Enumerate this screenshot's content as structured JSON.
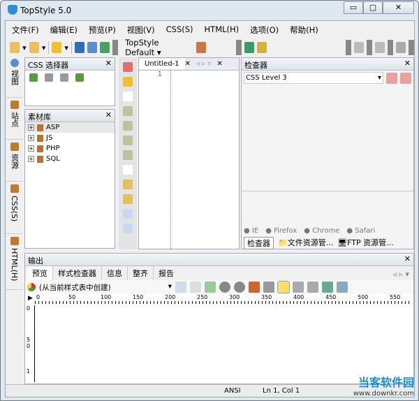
{
  "window": {
    "title": "TopStyle 5.0",
    "min": "▭",
    "max": "▢",
    "close": "✕"
  },
  "menu": [
    "文件(F)",
    "编辑(E)",
    "预览(P)",
    "视图(V)",
    "CSS(S)",
    "HTML(H)",
    "选项(O)",
    "帮助(H)"
  ],
  "toolbar": {
    "theme": "TopStyle Default ▾"
  },
  "vtabs": [
    "视图",
    "站点",
    "资源",
    "CSS(S)",
    "HTML(H)"
  ],
  "css_selector": {
    "title": "CSS 选择器",
    "close": "✕"
  },
  "assets": {
    "title": "素材库",
    "close": "✕",
    "items": [
      "ASP",
      "JS",
      "PHP",
      "SQL"
    ]
  },
  "editor": {
    "tab": "Untitled-1",
    "tab_close": "✕",
    "close": "✕",
    "line": "1"
  },
  "inspector": {
    "title": "检查器",
    "close": "✕",
    "level": "CSS Level 3",
    "browsers": [
      "IE",
      "Firefox",
      "Chrome",
      "Safari"
    ],
    "tabs": [
      "检查器",
      "文件资源管...",
      "FTP 资源管..."
    ]
  },
  "output": {
    "title": "输出",
    "close": "✕",
    "tabs": [
      "预览",
      "样式检查器",
      "信息",
      "整齐",
      "报告"
    ],
    "source": "(从当前样式表中创建)",
    "hruler": [
      "0",
      "50",
      "100",
      "150",
      "200",
      "250",
      "300",
      "350",
      "400",
      "450",
      "500",
      "550"
    ],
    "vruler": [
      "0",
      "5 0",
      "1"
    ]
  },
  "status": {
    "encoding": "ANSI",
    "position": "Ln 1, Col 1"
  },
  "watermark": {
    "name": "当客软件园",
    "url": "www.downkr.com"
  }
}
